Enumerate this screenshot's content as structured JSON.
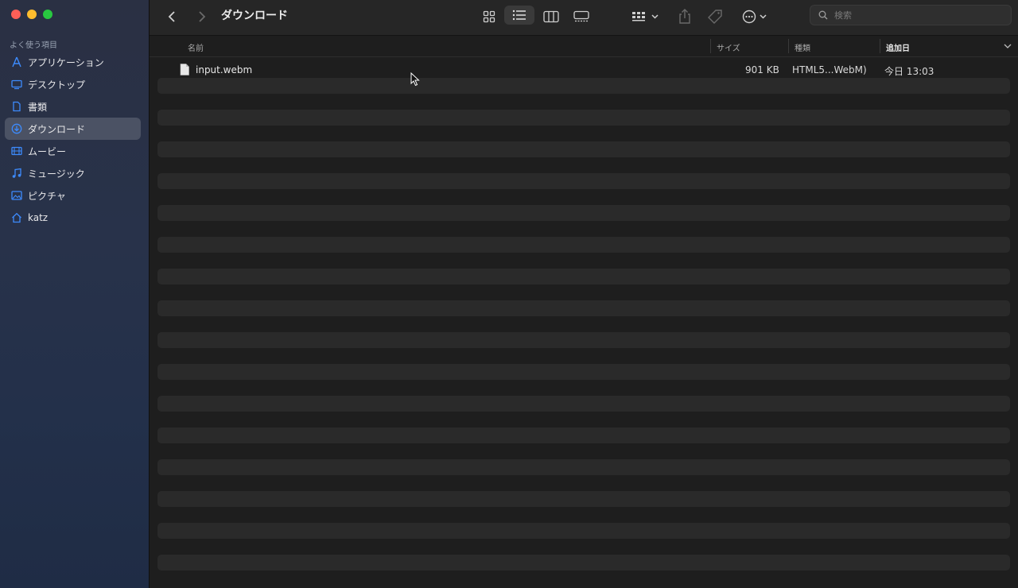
{
  "window": {
    "title": "ダウンロード"
  },
  "sidebar": {
    "section_label": "よく使う項目",
    "items": [
      {
        "label": "アプリケーション",
        "icon": "applications-icon",
        "active": false
      },
      {
        "label": "デスクトップ",
        "icon": "desktop-icon",
        "active": false
      },
      {
        "label": "書類",
        "icon": "documents-icon",
        "active": false
      },
      {
        "label": "ダウンロード",
        "icon": "downloads-icon",
        "active": true
      },
      {
        "label": "ムービー",
        "icon": "movies-icon",
        "active": false
      },
      {
        "label": "ミュージック",
        "icon": "music-icon",
        "active": false
      },
      {
        "label": "ピクチャ",
        "icon": "pictures-icon",
        "active": false
      },
      {
        "label": "katz",
        "icon": "home-icon",
        "active": false
      }
    ]
  },
  "search": {
    "placeholder": "検索"
  },
  "columns": {
    "name": "名前",
    "size": "サイズ",
    "kind": "種類",
    "date": "追加日"
  },
  "files": [
    {
      "name": "input.webm",
      "size": "901 KB",
      "kind": "HTML5...WebM)",
      "date": "今日 13:03"
    }
  ],
  "colors": {
    "accent": "#0a84ff",
    "sidebar_bg": "#27304a",
    "main_bg": "#1e1e1e",
    "stripe": "#2a2a2a"
  }
}
